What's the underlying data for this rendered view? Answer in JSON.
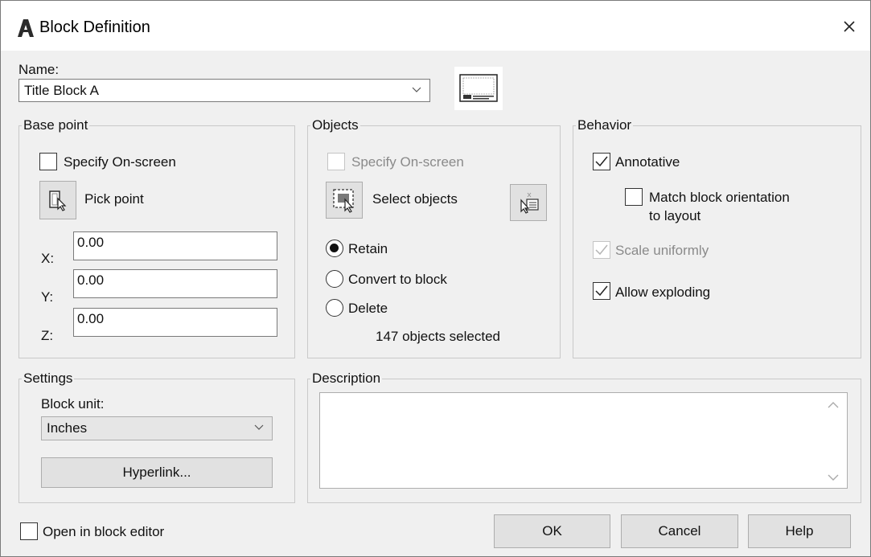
{
  "window": {
    "title": "Block Definition",
    "app_icon": "autocad-a-icon",
    "close_icon": "close-icon"
  },
  "name": {
    "label": "Name:",
    "value": "Title Block A"
  },
  "base_point": {
    "title": "Base point",
    "specify_on_screen": "Specify On-screen",
    "specify_checked": false,
    "pick_point": "Pick point",
    "x_label": "X:",
    "x_value": "0.00",
    "y_label": "Y:",
    "y_value": "0.00",
    "z_label": "Z:",
    "z_value": "0.00"
  },
  "objects": {
    "title": "Objects",
    "specify_on_screen": "Specify On-screen",
    "select_objects": "Select objects",
    "retain": "Retain",
    "convert_to_block": "Convert to block",
    "delete": "Delete",
    "selected_radio": "Retain",
    "status": "147 objects selected"
  },
  "behavior": {
    "title": "Behavior",
    "annotative": "Annotative",
    "annotative_checked": true,
    "match_orientation": "Match block orientation",
    "match_orientation_2": "to layout",
    "match_checked": false,
    "scale_uniformly": "Scale uniformly",
    "scale_checked": true,
    "allow_exploding": "Allow exploding",
    "exploding_checked": true
  },
  "settings": {
    "title": "Settings",
    "block_unit_label": "Block unit:",
    "block_unit_value": "Inches",
    "hyperlink": "Hyperlink..."
  },
  "description": {
    "title": "Description",
    "value": ""
  },
  "footer": {
    "open_in_editor": "Open in block editor",
    "open_checked": false,
    "ok": "OK",
    "cancel": "Cancel",
    "help": "Help"
  }
}
